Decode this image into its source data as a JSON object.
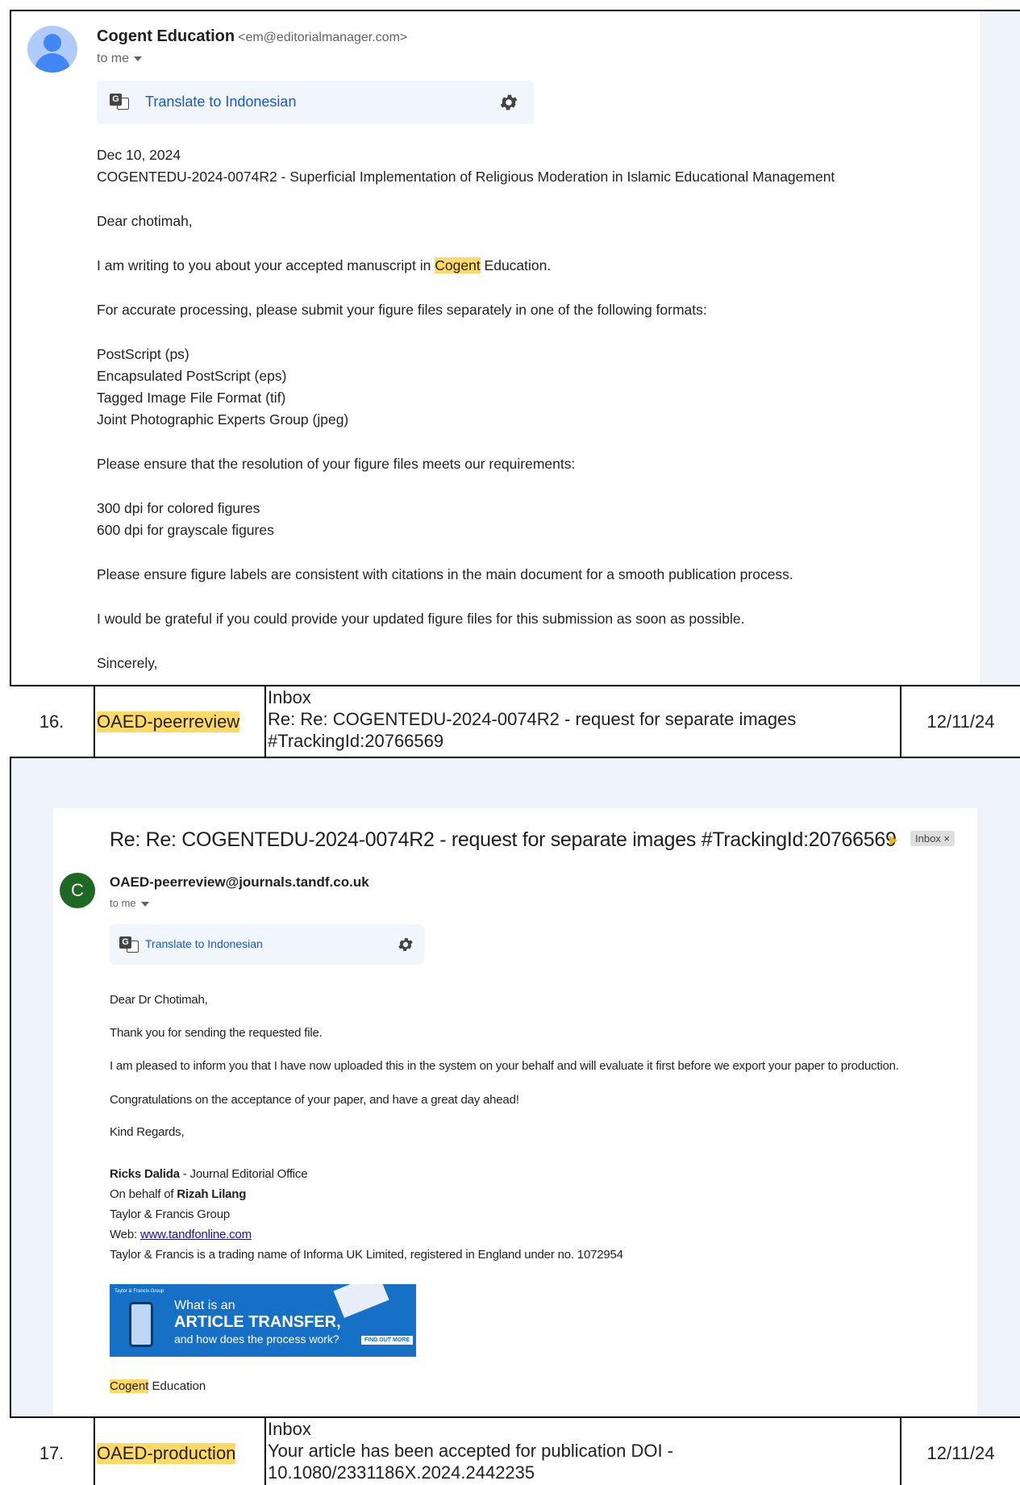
{
  "email1": {
    "sender_name": "Cogent Education",
    "sender_email": "<em@editorialmanager.com>",
    "to_me": "to me",
    "translate_label": "Translate to Indonesian",
    "date": "Dec 10, 2024",
    "subject_line": "COGENTEDU-2024-0074R2 - Superficial Implementation of Religious Moderation in Islamic Educational Management",
    "greeting": "Dear  chotimah,",
    "para1_before": "I am writing to you about your accepted manuscript in ",
    "para1_highlight": "Cogent",
    "para1_after": " Education.",
    "para2": "For accurate processing, please submit your figure files separately in one of the following formats:",
    "formats": [
      "PostScript (ps)",
      "Encapsulated PostScript (eps)",
      "Tagged Image File Format (tif)",
      "Joint Photographic Experts Group (jpeg)"
    ],
    "para3": "Please ensure that the resolution of your figure files meets our requirements:",
    "resolutions": [
      "300 dpi for colored figures",
      "600 dpi for grayscale figures"
    ],
    "para4": "Please ensure figure labels are consistent with citations in the main document for a smooth publication process.",
    "para5": "I would be grateful if you could provide your updated figure files for this submission as soon as possible.",
    "closing": "Sincerely,"
  },
  "rows": [
    {
      "number": "16.",
      "source": "OAED-peerreview",
      "folder": "Inbox",
      "subject": "Re: Re: COGENTEDU-2024-0074R2 - request for separate images #TrackingId:20766569",
      "date": "12/11/24"
    },
    {
      "number": "17.",
      "source": "OAED-production",
      "folder": "Inbox",
      "subject": "Your article has been accepted for publication DOI - 10.1080/2331186X.2024.2442235",
      "date": "12/11/24"
    }
  ],
  "email2": {
    "subject": "Re: Re: COGENTEDU-2024-0074R2 - request for separate images #TrackingId:20766569",
    "inbox_chip": "Inbox ×",
    "avatar_letter": "C",
    "sender": "OAED-peerreview@journals.tandf.co.uk",
    "to_me": "to me",
    "translate_label": "Translate to Indonesian",
    "greeting": "Dear Dr Chotimah,",
    "para1": "Thank you for sending the requested file.",
    "para2": "I am pleased to inform you that I have now uploaded this in the system on your behalf and will evaluate it first before we export your paper to production.",
    "para3": "Congratulations on the acceptance of your paper, and have a great day ahead!",
    "regards": "Kind Regards,",
    "sig_name": "Ricks Dalida",
    "sig_role": " - Journal Editorial Office",
    "sig_behalf_prefix": "On behalf of ",
    "sig_behalf_name": "Rizah Lilang",
    "sig_company": "Taylor & Francis Group",
    "sig_web_prefix": "Web: ",
    "sig_web_link": "www.tandfonline.com",
    "sig_legal": "Taylor & Francis is a trading name of Informa UK Limited, registered in England under no. 1072954",
    "banner": {
      "logo_text": "Taylor & Francis Group",
      "line1": "What is an",
      "line2": "ARTICLE TRANSFER,",
      "line3": "and how does the process work?",
      "button": "FIND OUT MORE"
    },
    "footer_highlight": "Cogent",
    "footer_rest": " Education"
  },
  "colors": {
    "highlight": "#ffd966",
    "link": "#1a57c9",
    "panel_bg": "#eff4fb",
    "avatar2_bg": "#1e6823",
    "banner_bg": "#1670c5"
  }
}
